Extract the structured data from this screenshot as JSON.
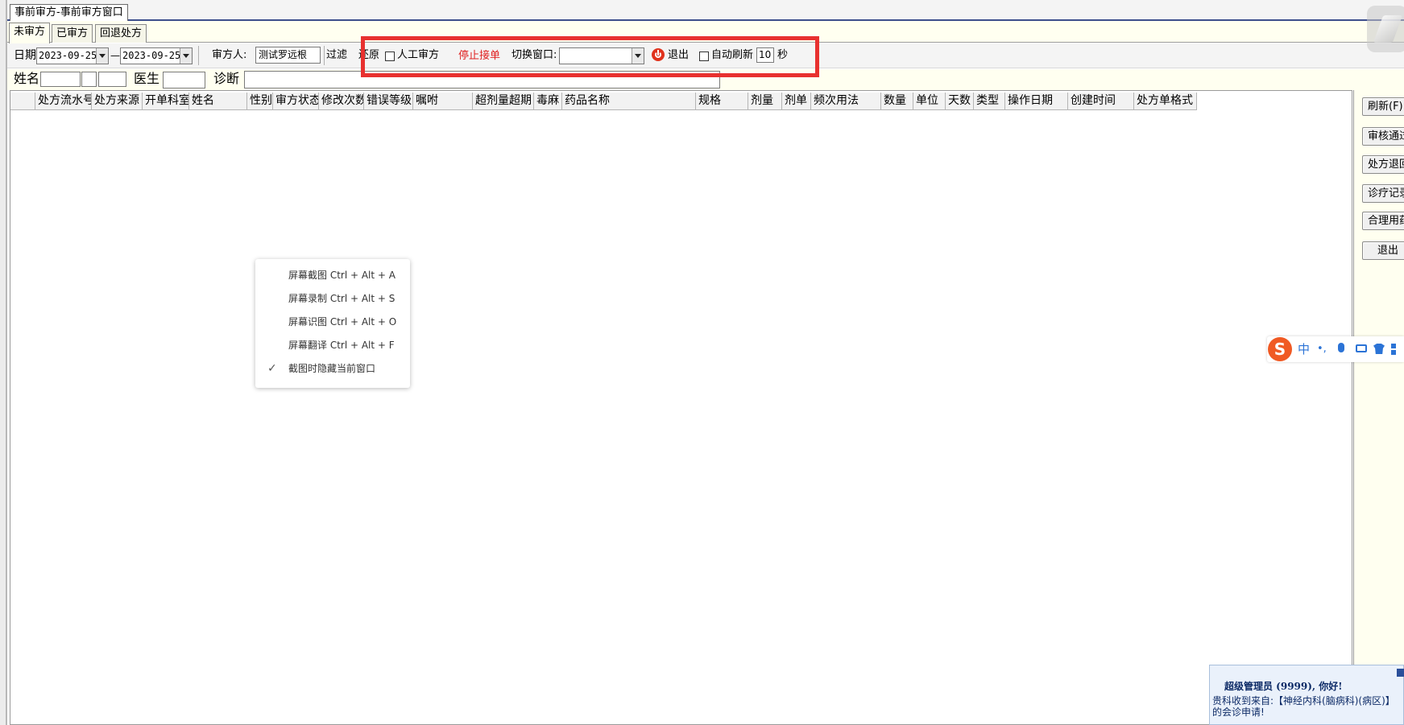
{
  "window": {
    "tab_title": "事前审方-事前审方窗口"
  },
  "tabs": [
    {
      "label": "未审方",
      "active": true
    },
    {
      "label": "已审方",
      "active": false
    },
    {
      "label": "回退处方",
      "active": false
    }
  ],
  "toolbar": {
    "date_label": "日期",
    "date_from": "2023-09-25",
    "date_sep": "—",
    "date_to": "2023-09-25",
    "reviewer_label": "审方人:",
    "reviewer_value": "测试罗远根",
    "filter_label": "过滤",
    "restore_label": "还原",
    "manual_review_label": "人工审方",
    "stop_order_label": "停止接单",
    "switch_window_label": "切换窗口:",
    "switch_window_value": "",
    "exit_label": "退出",
    "auto_refresh_label": "自动刷新",
    "refresh_seconds": "10",
    "seconds_unit": "秒"
  },
  "search": {
    "name_label": "姓名",
    "doctor_label": "医生",
    "diagnosis_label": "诊断"
  },
  "grid": {
    "columns": [
      "",
      "处方流水号",
      "处方来源",
      "开单科室",
      "姓名",
      "性别",
      "审方状态",
      "修改次数",
      "错误等级",
      "嘱咐",
      "超剂量超期",
      "毒麻",
      "药品名称",
      "规格",
      "剂量",
      "剂单",
      "频次用法",
      "数量",
      "单位",
      "天数",
      "类型",
      "操作日期",
      "创建时间",
      "处方单格式"
    ]
  },
  "right_buttons": [
    "刷新(F)",
    "审核通过",
    "处方退回",
    "诊疗记录",
    "合理用药",
    "退出"
  ],
  "context_menu": {
    "items": [
      {
        "label": "屏幕截图 Ctrl + Alt + A",
        "checked": false
      },
      {
        "label": "屏幕录制 Ctrl + Alt + S",
        "checked": false
      },
      {
        "label": "屏幕识图 Ctrl + Alt + O",
        "checked": false
      },
      {
        "label": "屏幕翻译 Ctrl + Alt + F",
        "checked": false
      },
      {
        "label": "截图时隐藏当前窗口",
        "checked": true
      }
    ]
  },
  "ime": {
    "mode": "中",
    "punct": "•,",
    "logo": "S"
  },
  "notification": {
    "greeting": "超级管理员 (9999), 你好!",
    "message_line1": "贵科收到来自:【神经内科(脑病科)(病区)】",
    "message_line2": "的会诊申请!"
  },
  "colors": {
    "highlight": "#e8312f",
    "stop_order": "#e02020",
    "power_icon": "#e0321c",
    "ime_logo": "#f05a24"
  }
}
